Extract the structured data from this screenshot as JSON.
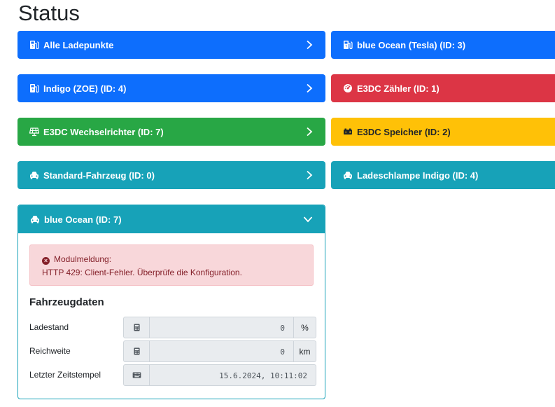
{
  "page": {
    "title": "Status"
  },
  "cards": {
    "alle": {
      "label": "Alle Ladepunkte",
      "icon": "charging-station-icon"
    },
    "blueOceanTesla": {
      "label": "blue Ocean (Tesla) (ID: 3)",
      "icon": "charging-station-icon"
    },
    "indigo": {
      "label": "Indigo (ZOE) (ID: 4)",
      "icon": "charging-station-icon"
    },
    "zaehler": {
      "label": "E3DC Zähler (ID: 1)",
      "icon": "gauge-icon"
    },
    "wechselrichter": {
      "label": "E3DC Wechselrichter (ID: 7)",
      "icon": "solar-panel-icon"
    },
    "speicher": {
      "label": "E3DC Speicher (ID: 2)",
      "icon": "battery-icon"
    },
    "standard": {
      "label": "Standard-Fahrzeug (ID: 0)",
      "icon": "car-icon"
    },
    "ladeschlampe": {
      "label": "Ladeschlampe Indigo (ID: 4)",
      "icon": "car-icon"
    }
  },
  "expanded": {
    "label": "blue Ocean (ID: 7)",
    "alert_title": "Modulmeldung:",
    "alert_message": "HTTP 429: Client-Fehler. Überprüfe die Konfiguration.",
    "section_title": "Fahrzeugdaten",
    "fields": [
      {
        "label": "Ladestand",
        "value": "0",
        "unit": "%"
      },
      {
        "label": "Reichweite",
        "value": "0",
        "unit": "km"
      },
      {
        "label": "Letzter Zeitstempel",
        "value": "15.6.2024, 10:11:02"
      }
    ]
  },
  "colors": {
    "primary": "#0d6efd",
    "danger": "#dc3545",
    "success": "#28a745",
    "warning": "#ffc107",
    "info": "#17a2b8"
  }
}
